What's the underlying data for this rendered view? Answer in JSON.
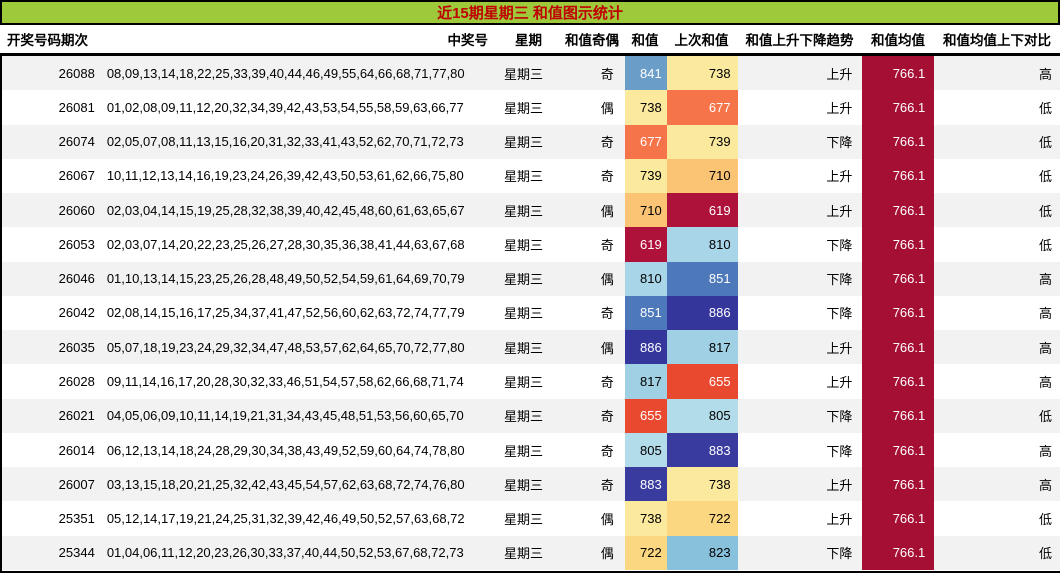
{
  "title": "近15期星期三 和值图示统计",
  "colors": {
    "title_bg": "#9dc93b",
    "title_fg": "#c00000",
    "stripe": "#f2f2f2",
    "mean_bg": "#a50f34",
    "mean_fg": "#ffffff"
  },
  "table": {
    "columns": [
      "开奖号码期次",
      "中奖号",
      "星期",
      "和值奇偶",
      "和值",
      "上次和值",
      "和值上升下降趋势",
      "和值均值",
      "和值均值上下对比"
    ],
    "rows": [
      {
        "period": "26088",
        "numbers": "08,09,13,14,18,22,25,33,39,40,44,46,49,55,64,66,68,71,77,80",
        "week": "星期三",
        "parity": "奇",
        "sum": "841",
        "sum_bg": "#6b9dc9",
        "sum_fg": "#ffffff",
        "prev": "738",
        "prev_bg": "#fbe99e",
        "prev_fg": "#000000",
        "trend": "上升",
        "mean": "766.1",
        "compare": "高"
      },
      {
        "period": "26081",
        "numbers": "01,02,08,09,11,12,20,32,34,39,42,43,53,54,55,58,59,63,66,77",
        "week": "星期三",
        "parity": "偶",
        "sum": "738",
        "sum_bg": "#fbe99e",
        "sum_fg": "#000000",
        "prev": "677",
        "prev_bg": "#f5744a",
        "prev_fg": "#ffffff",
        "trend": "上升",
        "mean": "766.1",
        "compare": "低"
      },
      {
        "period": "26074",
        "numbers": "02,05,07,08,11,13,15,16,20,31,32,33,41,43,52,62,70,71,72,73",
        "week": "星期三",
        "parity": "奇",
        "sum": "677",
        "sum_bg": "#f5744a",
        "sum_fg": "#ffffff",
        "prev": "739",
        "prev_bg": "#fbe99e",
        "prev_fg": "#000000",
        "trend": "下降",
        "mean": "766.1",
        "compare": "低"
      },
      {
        "period": "26067",
        "numbers": "10,11,12,13,14,16,19,23,24,26,39,42,43,50,53,61,62,66,75,80",
        "week": "星期三",
        "parity": "奇",
        "sum": "739",
        "sum_bg": "#fbe99e",
        "sum_fg": "#000000",
        "prev": "710",
        "prev_bg": "#fbc374",
        "prev_fg": "#000000",
        "trend": "上升",
        "mean": "766.1",
        "compare": "低"
      },
      {
        "period": "26060",
        "numbers": "02,03,04,14,15,19,25,28,32,38,39,40,42,45,48,60,61,63,65,67",
        "week": "星期三",
        "parity": "偶",
        "sum": "710",
        "sum_bg": "#fbc374",
        "sum_fg": "#000000",
        "prev": "619",
        "prev_bg": "#ae1139",
        "prev_fg": "#ffffff",
        "trend": "上升",
        "mean": "766.1",
        "compare": "低"
      },
      {
        "period": "26053",
        "numbers": "02,03,07,14,20,22,23,25,26,27,28,30,35,36,38,41,44,63,67,68",
        "week": "星期三",
        "parity": "奇",
        "sum": "619",
        "sum_bg": "#ae1139",
        "sum_fg": "#ffffff",
        "prev": "810",
        "prev_bg": "#a9d5e8",
        "prev_fg": "#000000",
        "trend": "下降",
        "mean": "766.1",
        "compare": "低"
      },
      {
        "period": "26046",
        "numbers": "01,10,13,14,15,23,25,26,28,48,49,50,52,54,59,61,64,69,70,79",
        "week": "星期三",
        "parity": "偶",
        "sum": "810",
        "sum_bg": "#a9d5e8",
        "sum_fg": "#000000",
        "prev": "851",
        "prev_bg": "#4d78ba",
        "prev_fg": "#ffffff",
        "trend": "下降",
        "mean": "766.1",
        "compare": "高"
      },
      {
        "period": "26042",
        "numbers": "02,08,14,15,16,17,25,34,37,41,47,52,56,60,62,63,72,74,77,79",
        "week": "星期三",
        "parity": "奇",
        "sum": "851",
        "sum_bg": "#4d78ba",
        "sum_fg": "#ffffff",
        "prev": "886",
        "prev_bg": "#35369c",
        "prev_fg": "#ffffff",
        "trend": "下降",
        "mean": "766.1",
        "compare": "高"
      },
      {
        "period": "26035",
        "numbers": "05,07,18,19,23,24,29,32,34,47,48,53,57,62,64,65,70,72,77,80",
        "week": "星期三",
        "parity": "偶",
        "sum": "886",
        "sum_bg": "#35369c",
        "sum_fg": "#ffffff",
        "prev": "817",
        "prev_bg": "#9fd0e4",
        "prev_fg": "#000000",
        "trend": "上升",
        "mean": "766.1",
        "compare": "高"
      },
      {
        "period": "26028",
        "numbers": "09,11,14,16,17,20,28,30,32,33,46,51,54,57,58,62,66,68,71,74",
        "week": "星期三",
        "parity": "奇",
        "sum": "817",
        "sum_bg": "#9fd0e4",
        "sum_fg": "#000000",
        "prev": "655",
        "prev_bg": "#e8492f",
        "prev_fg": "#ffffff",
        "trend": "上升",
        "mean": "766.1",
        "compare": "高"
      },
      {
        "period": "26021",
        "numbers": "04,05,06,09,10,11,14,19,21,31,34,43,45,48,51,53,56,60,65,70",
        "week": "星期三",
        "parity": "奇",
        "sum": "655",
        "sum_bg": "#e8492f",
        "sum_fg": "#ffffff",
        "prev": "805",
        "prev_bg": "#b3dcea",
        "prev_fg": "#000000",
        "trend": "下降",
        "mean": "766.1",
        "compare": "低"
      },
      {
        "period": "26014",
        "numbers": "06,12,13,14,18,24,28,29,30,34,38,43,49,52,59,60,64,74,78,80",
        "week": "星期三",
        "parity": "奇",
        "sum": "805",
        "sum_bg": "#b3dcea",
        "sum_fg": "#000000",
        "prev": "883",
        "prev_bg": "#393b9f",
        "prev_fg": "#ffffff",
        "trend": "下降",
        "mean": "766.1",
        "compare": "高"
      },
      {
        "period": "26007",
        "numbers": "03,13,15,18,20,21,25,32,42,43,45,54,57,62,63,68,72,74,76,80",
        "week": "星期三",
        "parity": "奇",
        "sum": "883",
        "sum_bg": "#393b9f",
        "sum_fg": "#ffffff",
        "prev": "738",
        "prev_bg": "#fbe99e",
        "prev_fg": "#000000",
        "trend": "上升",
        "mean": "766.1",
        "compare": "高"
      },
      {
        "period": "25351",
        "numbers": "05,12,14,17,19,21,24,25,31,32,39,42,46,49,50,52,57,63,68,72",
        "week": "星期三",
        "parity": "偶",
        "sum": "738",
        "sum_bg": "#fbe99e",
        "sum_fg": "#000000",
        "prev": "722",
        "prev_bg": "#fcd781",
        "prev_fg": "#000000",
        "trend": "上升",
        "mean": "766.1",
        "compare": "低"
      },
      {
        "period": "25344",
        "numbers": "01,04,06,11,12,20,23,26,30,33,37,40,44,50,52,53,67,68,72,73",
        "week": "星期三",
        "parity": "偶",
        "sum": "722",
        "sum_bg": "#fcd781",
        "sum_fg": "#000000",
        "prev": "823",
        "prev_bg": "#87c1dc",
        "prev_fg": "#000000",
        "trend": "下降",
        "mean": "766.1",
        "compare": "低"
      }
    ]
  }
}
